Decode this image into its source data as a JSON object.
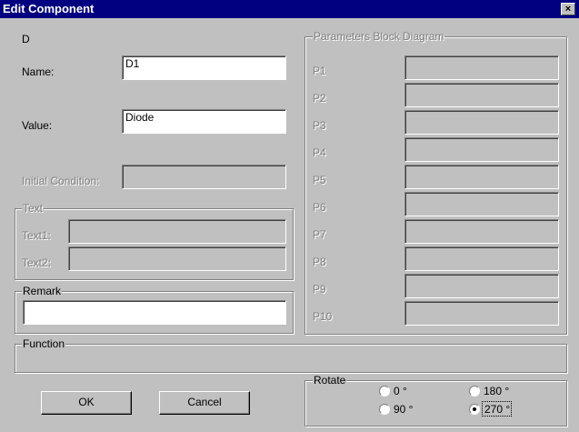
{
  "window": {
    "title": "Edit Component",
    "close_glyph": "×"
  },
  "component_type": "D",
  "fields": {
    "name": {
      "label": "Name:",
      "value": "D1"
    },
    "value": {
      "label": "Value:",
      "value": "Diode"
    },
    "initial_condition": {
      "label": "Initial Condition:",
      "value": ""
    }
  },
  "text_group": {
    "legend": "Text",
    "text1": {
      "label": "Text1:",
      "value": ""
    },
    "text2": {
      "label": "Text2:",
      "value": ""
    }
  },
  "remark_group": {
    "legend": "Remark",
    "value": ""
  },
  "function_group": {
    "legend": "Function"
  },
  "parameters": {
    "legend": "Parameters Block Diagram",
    "rows": [
      {
        "label": "P1",
        "value": ""
      },
      {
        "label": "P2",
        "value": ""
      },
      {
        "label": "P3",
        "value": ""
      },
      {
        "label": "P4",
        "value": ""
      },
      {
        "label": "P5",
        "value": ""
      },
      {
        "label": "P6",
        "value": ""
      },
      {
        "label": "P7",
        "value": ""
      },
      {
        "label": "P8",
        "value": ""
      },
      {
        "label": "P9",
        "value": ""
      },
      {
        "label": "P10",
        "value": ""
      }
    ]
  },
  "rotate": {
    "legend": "Rotate",
    "options": [
      "0 °",
      "180 °",
      "90 °",
      "270 °"
    ],
    "selected": "270 °"
  },
  "buttons": {
    "ok": "OK",
    "cancel": "Cancel"
  }
}
